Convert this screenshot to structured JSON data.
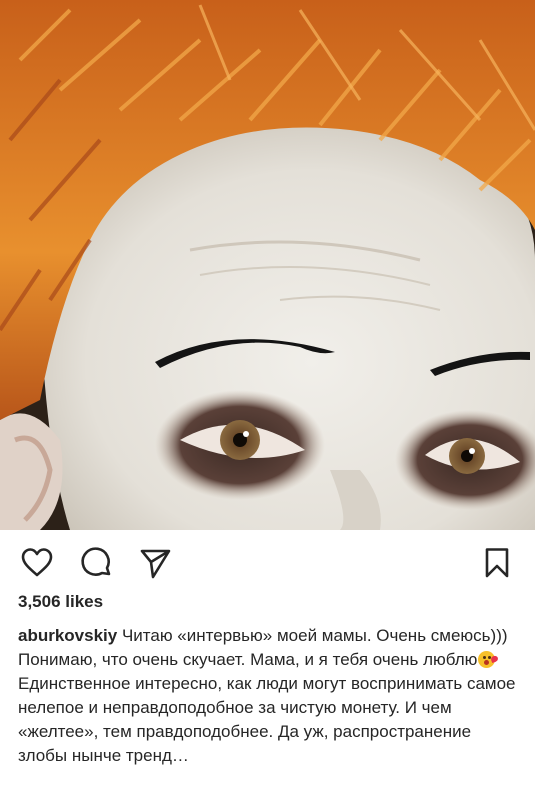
{
  "post": {
    "likes": "3,506 likes",
    "username": "aburkovskiy",
    "caption_first": " Читаю «интервью» моей мамы. Очень смеюсь))) Понимаю, что очень скучает. Мама, и я тебя очень люблю",
    "caption_second": "Единственное интересно, как люди могут воспринимать самое нелепое и неправдоподобное за чистую монету.  И чем «желтее», тем правдоподобнее. Да уж, распространение злобы нынче тренд…",
    "emoji": "kissing-heart-emoji"
  },
  "icons": {
    "like": "heart-outline-icon",
    "comment": "comment-bubble-icon",
    "share": "paper-plane-icon",
    "save": "bookmark-icon"
  },
  "colors": {
    "text": "#262626",
    "hair": "#d9782a",
    "skin": "#e9e5de"
  }
}
